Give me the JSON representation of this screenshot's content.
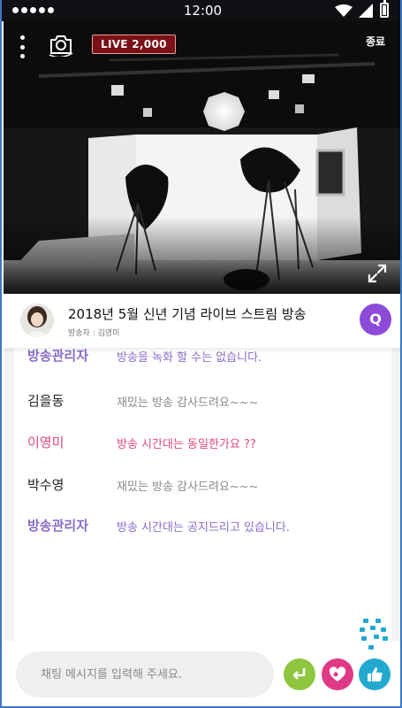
{
  "status_bar": {
    "time": "12:00"
  },
  "video": {
    "live_label": "LIVE",
    "viewer_count": "2,000",
    "end_label": "종료",
    "icons": [
      "more-vertical-icon",
      "camera-switch-icon",
      "expand-icon"
    ]
  },
  "stream": {
    "title": "2018년 5월 신년 기념 라이브 스트림 방송",
    "broadcaster": "방송자 : 김영미",
    "q_label": "Q"
  },
  "chat": {
    "messages": [
      {
        "name": "방송관리자",
        "text": "방송을 녹화 할 수는 없습니다.",
        "style": "admin"
      },
      {
        "name": "김을동",
        "text": "재밌는 방송 감사드려요~~~",
        "style": "normal"
      },
      {
        "name": "이영미",
        "text": "방송 시간대는 동일한가요 ??",
        "style": "highlight"
      },
      {
        "name": "박수영",
        "text": "재밌는 방송 감사드려요~~~",
        "style": "normal"
      },
      {
        "name": "방송관리자",
        "text": "방송 시간대는 공지드리고 있습니다.",
        "style": "admin"
      }
    ]
  },
  "input": {
    "placeholder": "채팅 메시지를 입력해 주세요.",
    "icons": [
      "send-icon",
      "heart-icon",
      "thumbs-up-icon"
    ]
  },
  "colors": {
    "live_badge": "#7a1018",
    "q_button": "#8c4ad8",
    "admin_text": "#8a6cc7",
    "highlight_text": "#e04a76",
    "send_button": "#8ec63f",
    "heart_button": "#e03a86",
    "like_button": "#23a9cf"
  }
}
